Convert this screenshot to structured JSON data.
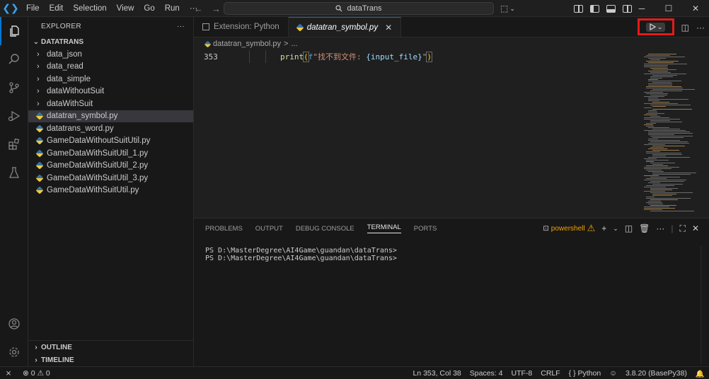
{
  "menu": [
    "File",
    "Edit",
    "Selection",
    "View",
    "Go",
    "Run",
    "···"
  ],
  "command_center": {
    "text": "dataTrans"
  },
  "sidebar": {
    "header": "EXPLORER",
    "more": "···",
    "root": "DATATRANS",
    "folders": [
      "data_json",
      "data_read",
      "data_simple",
      "dataWithoutSuit",
      "dataWithSuit"
    ],
    "files": [
      {
        "name": "datatran_symbol.py",
        "selected": true
      },
      {
        "name": "datatrans_word.py"
      },
      {
        "name": "GameDataWithoutSuitUtil.py"
      },
      {
        "name": "GameDataWithSuitUtil_1.py"
      },
      {
        "name": "GameDataWithSuitUtil_2.py"
      },
      {
        "name": "GameDataWithSuitUtil_3.py"
      },
      {
        "name": "GameDataWithSuitUtil.py"
      }
    ],
    "outline": "OUTLINE",
    "timeline": "TIMELINE"
  },
  "tabs": [
    {
      "label": "Extension: Python",
      "active": false
    },
    {
      "label": "datatran_symbol.py",
      "active": true
    }
  ],
  "breadcrumb": {
    "file": "datatran_symbol.py",
    "sep": ">",
    "rest": "..."
  },
  "code": {
    "line_number": "353",
    "fn": "print",
    "open": "(",
    "prefix": "f",
    "string": "\"找不到文件: ",
    "var": "{input_file}",
    "string_end": "\"",
    "close": ")"
  },
  "panel": {
    "tabs": [
      "PROBLEMS",
      "OUTPUT",
      "DEBUG CONSOLE",
      "TERMINAL",
      "PORTS"
    ],
    "active_tab": "TERMINAL",
    "shell": "powershell",
    "terminal_lines": [
      "PS D:\\MasterDegree\\AI4Game\\guandan\\dataTrans>",
      "PS D:\\MasterDegree\\AI4Game\\guandan\\dataTrans>"
    ]
  },
  "statusbar": {
    "errors": "0",
    "warnings": "0",
    "position": "Ln 353, Col 38",
    "spaces": "Spaces: 4",
    "encoding": "UTF-8",
    "eol": "CRLF",
    "language": "Python",
    "language_braces": "{ }",
    "interpreter": "3.8.20 (BasePy38)"
  },
  "colors": {
    "accent": "#0078d4",
    "highlight_box": "#e31b1b",
    "warning": "#f0a202"
  }
}
